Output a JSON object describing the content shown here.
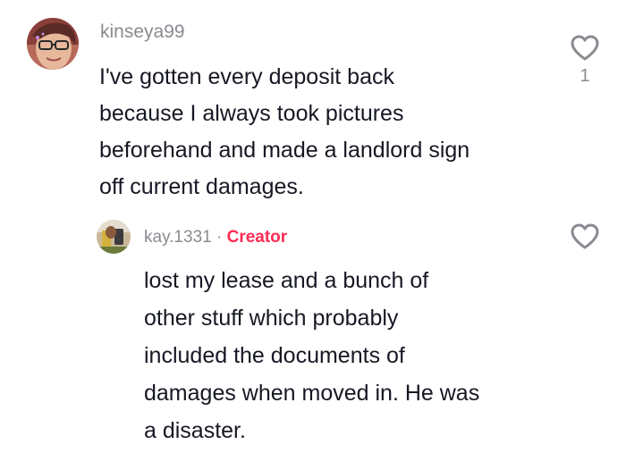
{
  "comments": [
    {
      "username": "kinseya99",
      "text": "I've gotten every deposit back\nbecause I always took pictures\nbeforehand and made a landlord sign\noff current damages.",
      "likes": "1",
      "avatar_icon": "user-avatar-photo"
    }
  ],
  "reply": {
    "username": "kay.1331",
    "separator": "·",
    "badge": "Creator",
    "text": "lost my lease and a bunch of\nother stuff which probably\nincluded the documents of\ndamages when moved in. He was\na disaster.",
    "avatar_icon": "user-avatar-photo"
  },
  "colors": {
    "creator_badge": "#fe2c55",
    "secondary_text": "#8a8b91",
    "primary_text": "#161823"
  }
}
